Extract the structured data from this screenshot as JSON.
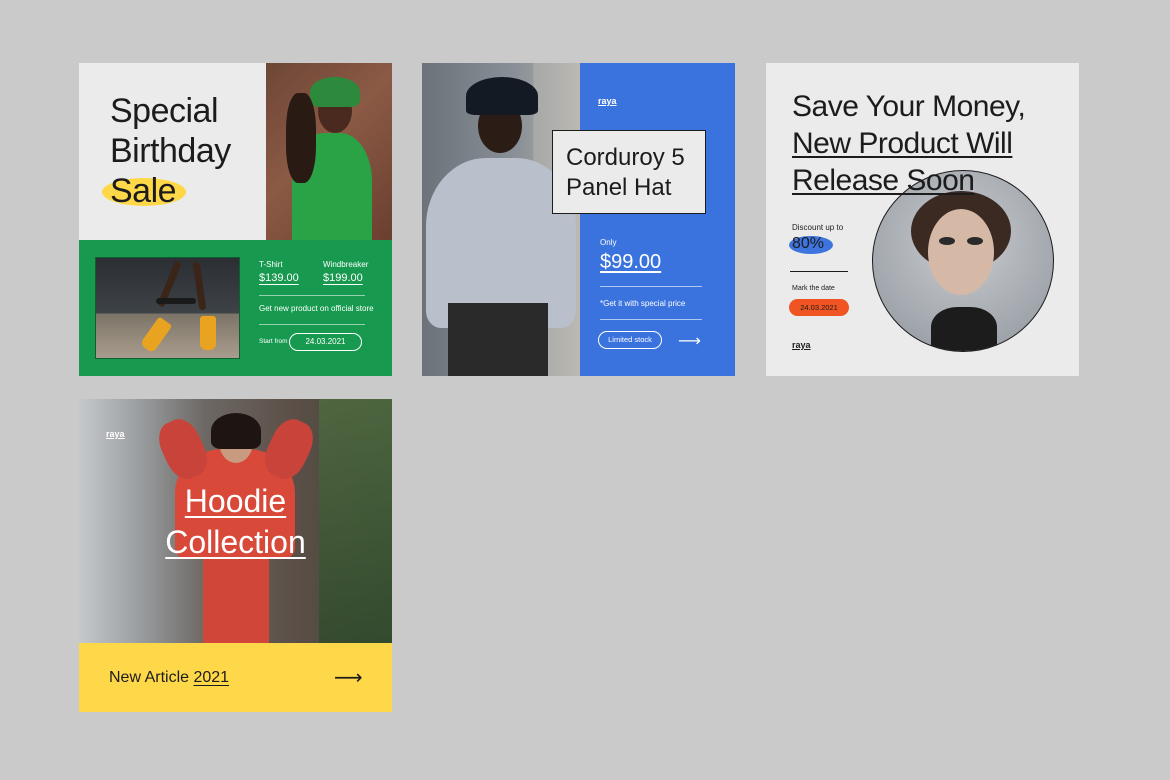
{
  "cards": {
    "birthday": {
      "title_line1": "Special",
      "title_line2": "Birthday",
      "title_highlight": "Sale",
      "item1_label": "T-Shirt",
      "item1_price": "$139.00",
      "item2_label": "Windbreaker",
      "item2_price": "$199.00",
      "cta": "Get new product on official store",
      "start_label": "Start from",
      "start_date": "24.03.2021",
      "colors": {
        "green": "#179a4f",
        "highlight": "#ffd84a"
      }
    },
    "hat": {
      "logo": "raya",
      "title_line1": "Corduroy 5",
      "title_line2": "Panel Hat",
      "only_label": "Only",
      "price": "$99.00",
      "note": "*Get it with special price",
      "stock_button": "Limited stock",
      "arrow_icon": "arrow-right-icon",
      "colors": {
        "blue": "#3b73de"
      }
    },
    "save": {
      "title_line1": "Save Your Money,",
      "title_line2": "New Product Will",
      "title_line3": "Release Soon",
      "discount_label": "Discount up to",
      "discount_value": "80%",
      "mark_label": "Mark the date",
      "date": "24.03.2021",
      "logo": "raya",
      "colors": {
        "orange": "#f05423",
        "blue": "#3d74de"
      }
    },
    "hoodie": {
      "logo": "raya",
      "title_line1": "Hoodie",
      "title_line2": "Collection",
      "footer_text": "New Article",
      "footer_year": "2021",
      "arrow_icon": "arrow-right-icon",
      "colors": {
        "yellow": "#ffd84a"
      }
    }
  }
}
